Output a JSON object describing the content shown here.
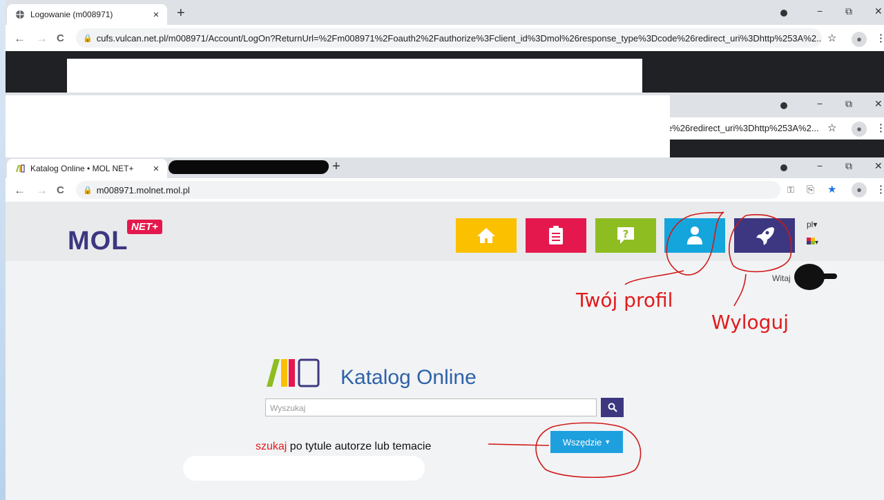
{
  "browser1": {
    "tab_title": "Logowanie (m008971)",
    "url": "cufs.vulcan.net.pl/m008971/Account/LogOn?ReturnUrl=%2Fm008971%2Foauth2%2Fauthorize%3Fclient_id%3Dmol%26response_type%3Dcode%26redirect_uri%3Dhttp%253A%2..."
  },
  "browser2": {
    "url_fragment": "e%26redirect_uri%3Dhttp%253A%2..."
  },
  "browser3": {
    "tab_title": "Katalog Online • MOL NET+",
    "url": "m008971.molnet.mol.pl"
  },
  "chrome": {
    "new_tab": "+",
    "close": "×",
    "minimize": "−",
    "restore": "⧉",
    "window_close": "✕",
    "back": "←",
    "forward": "→",
    "reload": "C",
    "star": "☆",
    "star_filled": "★",
    "key": "⚿",
    "share": "⎘",
    "menu": "⋮"
  },
  "mol": {
    "logo_text": "MOL",
    "logo_badge": "NET+",
    "lang": "pl",
    "welcome": "Witaj",
    "catalog_title": "Katalog Online",
    "search_placeholder": "Wyszukaj",
    "search_icon": "search-icon",
    "search_hint_red": "szukaj",
    "search_hint_rest": " po tytule autorze lub temacie",
    "dropdown_label": "Wszędzie",
    "tile_colors": [
      "#fbc000",
      "#e5184d",
      "#8ebd22",
      "#14a5dd",
      "#3c3780"
    ],
    "tiles": [
      "home-icon",
      "list-icon",
      "help-icon",
      "profile-icon",
      "rocket-icon"
    ]
  },
  "annotations": {
    "profile": "Twój profil",
    "logout": "Wyloguj"
  }
}
